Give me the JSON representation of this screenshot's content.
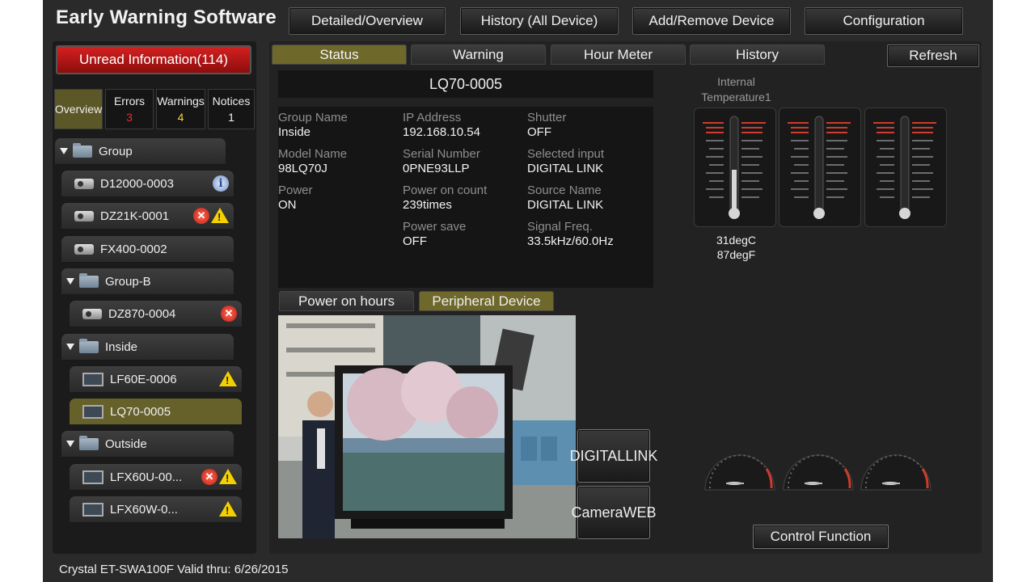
{
  "app": {
    "title": "Early Warning Software"
  },
  "top_buttons": [
    "Detailed/Overview",
    "History (All Device)",
    "Add/Remove Device",
    "Configuration"
  ],
  "unread": "Unread Information(114)",
  "filter_tabs": [
    {
      "label": "Overview",
      "count": ""
    },
    {
      "label": "Errors",
      "count": "3"
    },
    {
      "label": "Warnings",
      "count": "4"
    },
    {
      "label": "Notices",
      "count": "1"
    }
  ],
  "tree": [
    {
      "label": "Group"
    },
    {
      "label": "D12000-0003"
    },
    {
      "label": "DZ21K-0001"
    },
    {
      "label": "FX400-0002"
    },
    {
      "label": "Group-B"
    },
    {
      "label": "DZ870-0004"
    },
    {
      "label": "Inside"
    },
    {
      "label": "LF60E-0006"
    },
    {
      "label": "LQ70-0005"
    },
    {
      "label": "Outside"
    },
    {
      "label": "LFX60U-00..."
    },
    {
      "label": "LFX60W-0..."
    }
  ],
  "tabs": [
    "Status",
    "Warning",
    "Hour Meter",
    "History"
  ],
  "refresh": "Refresh",
  "device": {
    "name": "LQ70-0005",
    "fields": [
      {
        "label": "Group Name",
        "value": "Inside"
      },
      {
        "label": "IP Address",
        "value": "192.168.10.54"
      },
      {
        "label": "Shutter",
        "value": "OFF"
      },
      {
        "label": "Model Name",
        "value": "98LQ70J"
      },
      {
        "label": "Serial Number",
        "value": "0PNE93LLP"
      },
      {
        "label": "Selected input",
        "value": "DIGITAL LINK"
      },
      {
        "label": "Power",
        "value": "ON"
      },
      {
        "label": "Power on count",
        "value": "239times"
      },
      {
        "label": "Source Name",
        "value": "DIGITAL LINK"
      },
      {
        "label": "Power save",
        "value": "OFF"
      },
      {
        "label": "Signal Freq.",
        "value": "33.5kHz/60.0Hz"
      }
    ]
  },
  "subtabs": [
    "Power on hours",
    "Peripheral Device"
  ],
  "side_buttons": {
    "digital_link": "DIGITAL LINK",
    "camera_web": "Camera WEB"
  },
  "temperature": {
    "label": "Internal Temperature1",
    "celsius": "31degC",
    "fahrenheit": "87degF"
  },
  "control_button": "Control Function",
  "footer": "Crystal  ET-SWA100F  Valid thru: 6/26/2015",
  "colors": {
    "active_tab": "#6e682b",
    "unread": "#c41818",
    "error": "#d42a1e",
    "warning": "#f4d000",
    "errors_count": "#e03030",
    "warnings_count": "#f2d23a"
  }
}
